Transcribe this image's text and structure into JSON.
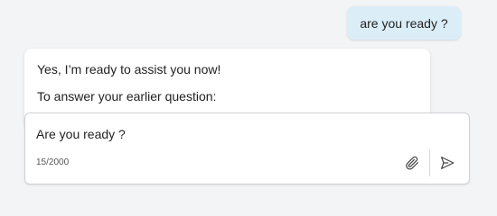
{
  "conversation": {
    "user_message": "are you ready ?",
    "assistant_lines": [
      "Yes, I’m ready to assist you now!",
      "To answer your earlier question:"
    ]
  },
  "composer": {
    "input_value": "Are you ready ?",
    "char_count": "15/2000",
    "attach_icon": "paperclip-icon",
    "send_icon": "send-icon"
  }
}
